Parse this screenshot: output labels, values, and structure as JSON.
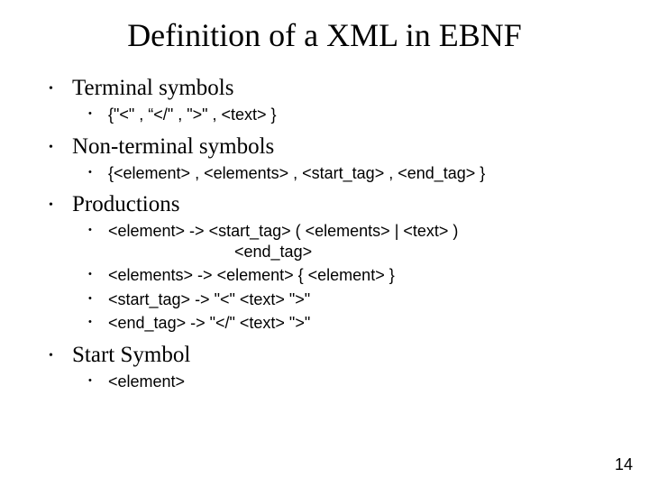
{
  "title": "Definition of a XML in EBNF",
  "sections": {
    "terminal": {
      "heading": "Terminal symbols",
      "items": [
        "{\"<\" , “</\" , \">\" , <text> }"
      ]
    },
    "nonterminal": {
      "heading": "Non-terminal symbols",
      "items": [
        "{<element> , <elements> , <start_tag> , <end_tag> }"
      ]
    },
    "productions": {
      "heading": "Productions",
      "items": [
        {
          "line": "<element> -> <start_tag> ( <elements> | <text> )",
          "cont": "<end_tag>"
        },
        {
          "line": "<elements> -> <element> { <element> }"
        },
        {
          "line": "<start_tag> -> \"<\" <text> \">\""
        },
        {
          "line": "<end_tag> -> \"</\" <text> \">\""
        }
      ]
    },
    "start": {
      "heading": "Start Symbol",
      "items": [
        "<element>"
      ]
    }
  },
  "page_number": "14"
}
